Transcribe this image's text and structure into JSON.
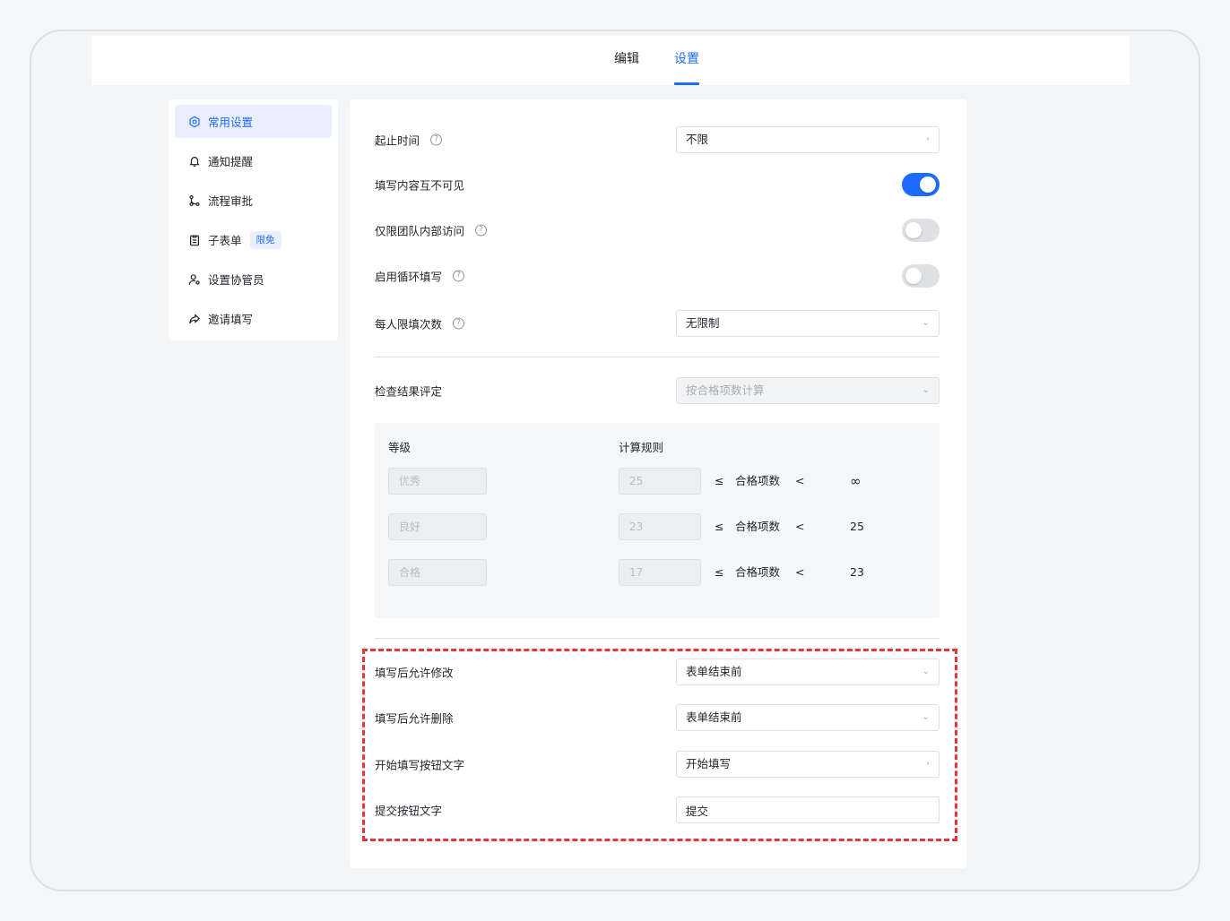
{
  "tabs": {
    "edit": "编辑",
    "settings": "设置"
  },
  "sidebar": {
    "items": [
      {
        "label": "常用设置",
        "icon": "settings-icon",
        "active": true
      },
      {
        "label": "通知提醒",
        "icon": "bell-icon"
      },
      {
        "label": "流程审批",
        "icon": "flow-icon"
      },
      {
        "label": "子表单",
        "icon": "clipboard-icon",
        "badge": "限免"
      },
      {
        "label": "设置协管员",
        "icon": "user-settings-icon"
      },
      {
        "label": "邀请填写",
        "icon": "share-icon"
      }
    ]
  },
  "settings": {
    "time_range": {
      "label": "起止时间",
      "value": "不限"
    },
    "hide_content": {
      "label": "填写内容互不可见",
      "on": true
    },
    "team_only": {
      "label": "仅限团队内部访问",
      "on": false
    },
    "loop_fill": {
      "label": "启用循环填写",
      "on": false
    },
    "limit_per_user": {
      "label": "每人限填次数",
      "value": "无限制"
    },
    "result_eval": {
      "label": "检查结果评定",
      "value": "按合格项数计算"
    },
    "grades": {
      "header_level": "等级",
      "header_rule": "计算规则",
      "rows": [
        {
          "level": "优秀",
          "min": "25",
          "leq": "≤",
          "item": "合格项数",
          "lt": "<",
          "max": "∞"
        },
        {
          "level": "良好",
          "min": "23",
          "leq": "≤",
          "item": "合格项数",
          "lt": "<",
          "max": "25"
        },
        {
          "level": "合格",
          "min": "17",
          "leq": "≤",
          "item": "合格项数",
          "lt": "<",
          "max": "23"
        }
      ]
    },
    "allow_edit": {
      "label": "填写后允许修改",
      "value": "表单结束前"
    },
    "allow_delete": {
      "label": "填写后允许删除",
      "value": "表单结束前"
    },
    "start_button_text": {
      "label": "开始填写按钮文字",
      "value": "开始填写"
    },
    "submit_button_text": {
      "label": "提交按钮文字",
      "value": "提交"
    }
  }
}
